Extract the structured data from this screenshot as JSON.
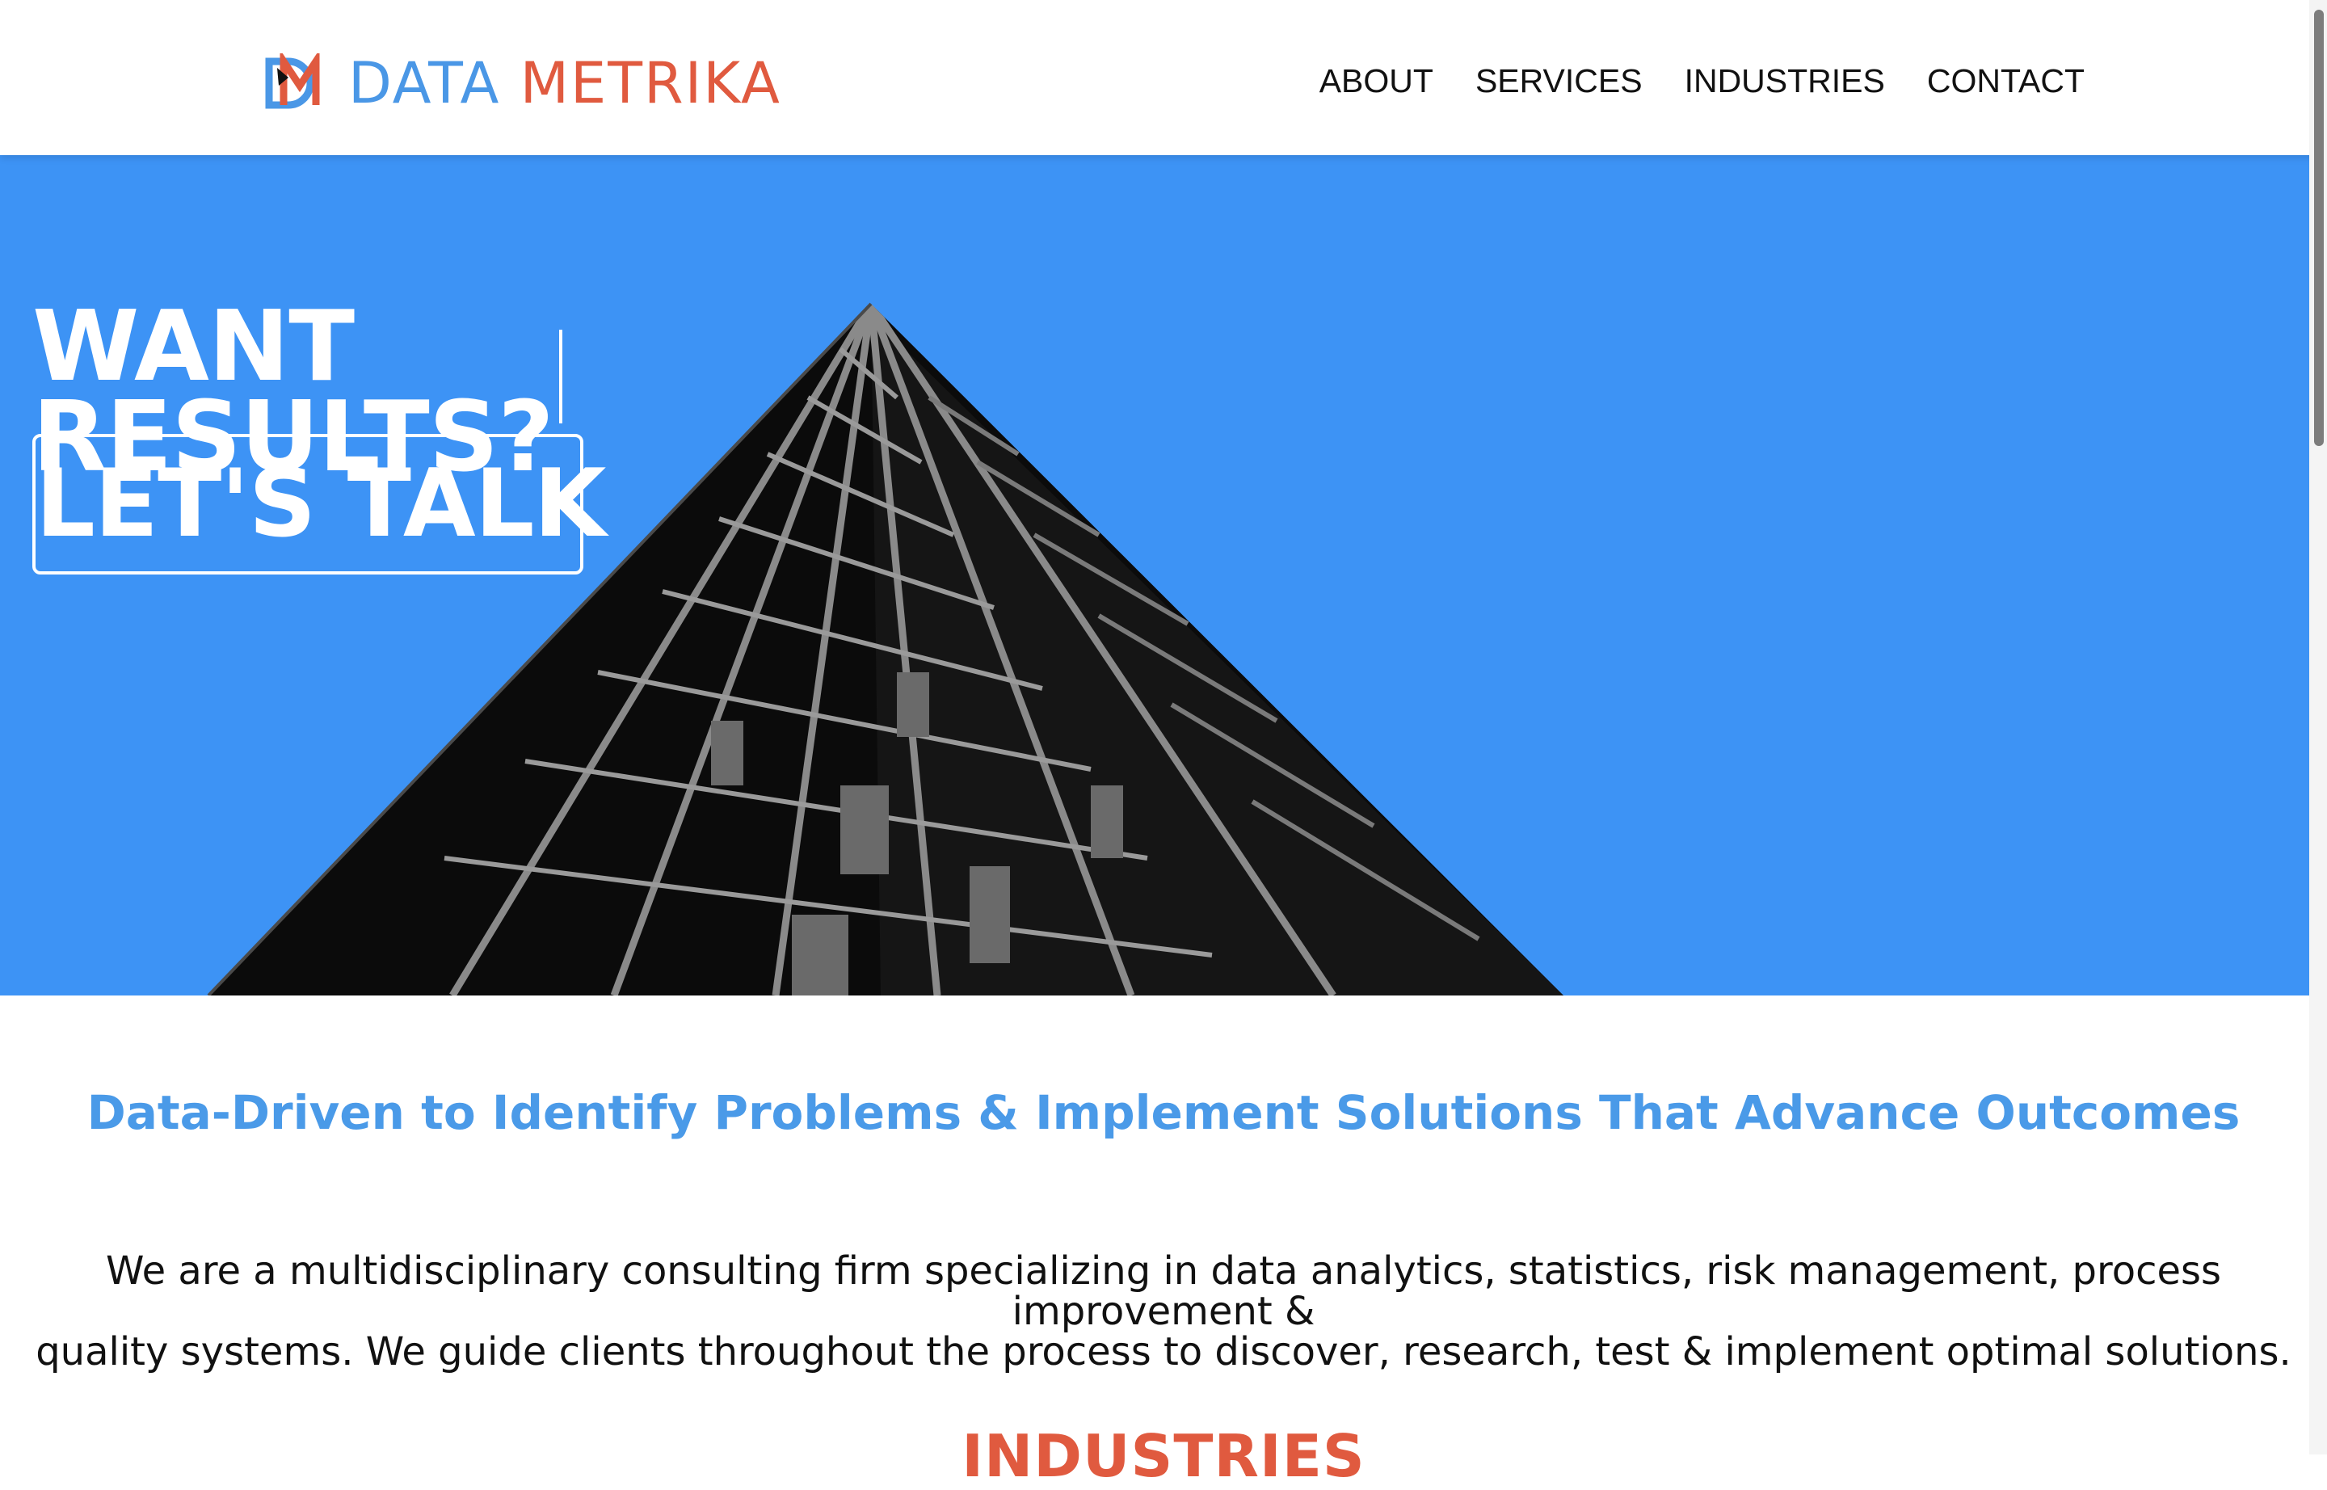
{
  "brand": {
    "monogram": "DM",
    "name_part1": "DATA",
    "name_part2": "METRIKA",
    "colors": {
      "blue": "#4a97e6",
      "orange": "#e05a3f"
    }
  },
  "nav": {
    "items": [
      {
        "label": "ABOUT"
      },
      {
        "label": "SERVICES"
      },
      {
        "label": "INDUSTRIES"
      },
      {
        "label": "CONTACT"
      }
    ]
  },
  "hero": {
    "line1": "WANT",
    "line2": "RESULTS?",
    "cta_label": "LET'S TALK",
    "background_color": "#3d93f5",
    "image": "skyscraper-looking-up"
  },
  "tagline": "Data-Driven to Identify Problems & Implement Solutions That Advance Outcomes",
  "intro": {
    "line1": "We are a multidisciplinary consulting firm specializing in data analytics, statistics, risk management, process improvement &",
    "line2": "quality systems. We guide clients throughout the process to discover, research, test & implement optimal solutions."
  },
  "sections": {
    "industries_heading": "INDUSTRIES"
  }
}
